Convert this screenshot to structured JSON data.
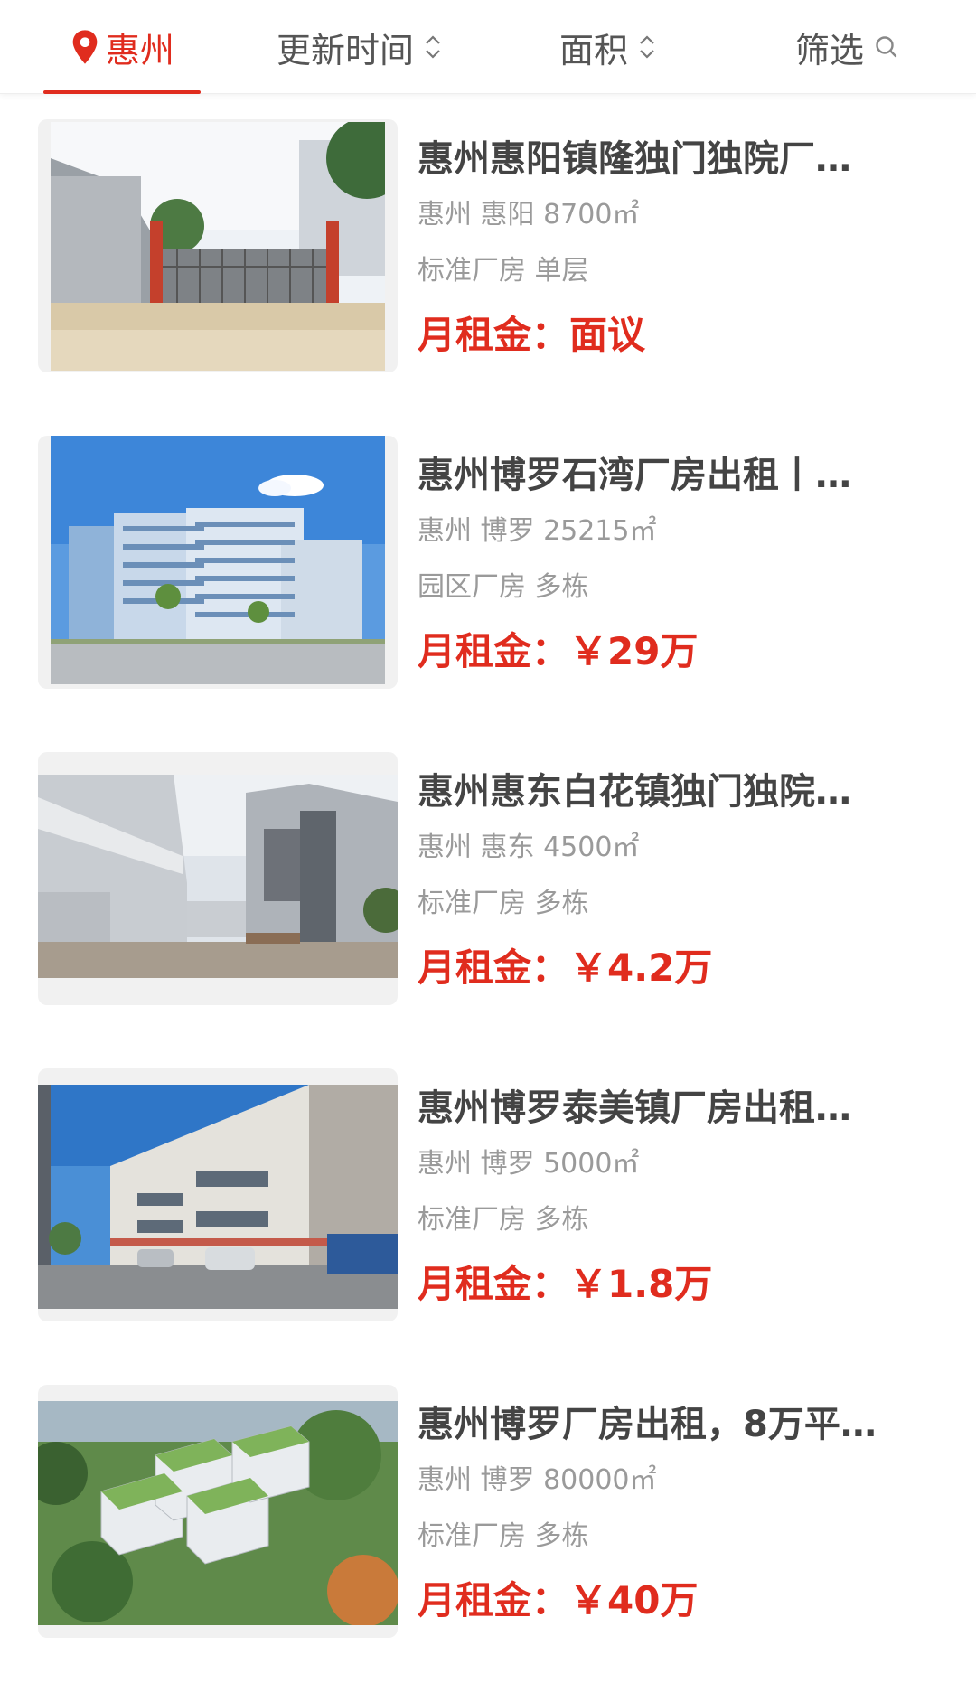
{
  "tabs": {
    "city": "惠州",
    "update_time": "更新时间",
    "area": "面积",
    "filter": "筛选"
  },
  "colors": {
    "accent": "#e02c1e",
    "muted": "#9a9a9a",
    "title": "#444444"
  },
  "listings": [
    {
      "title": "惠州惠阳镇隆独门独院厂…",
      "location": "惠州 惠阳 8700㎡",
      "type": "标准厂房 单层",
      "price": "月租金：面议"
    },
    {
      "title": "惠州博罗石湾厂房出租丨…",
      "location": "惠州 博罗 25215㎡",
      "type": "园区厂房 多栋",
      "price": "月租金：￥29万"
    },
    {
      "title": "惠州惠东白花镇独门独院…",
      "location": "惠州 惠东 4500㎡",
      "type": "标准厂房 多栋",
      "price": "月租金：￥4.2万"
    },
    {
      "title": "惠州博罗泰美镇厂房出租…",
      "location": "惠州 博罗 5000㎡",
      "type": "标准厂房 多栋",
      "price": "月租金：￥1.8万"
    },
    {
      "title": "惠州博罗厂房出租，8万平…",
      "location": "惠州 博罗 80000㎡",
      "type": "标准厂房 多栋",
      "price": "月租金：￥40万"
    }
  ]
}
